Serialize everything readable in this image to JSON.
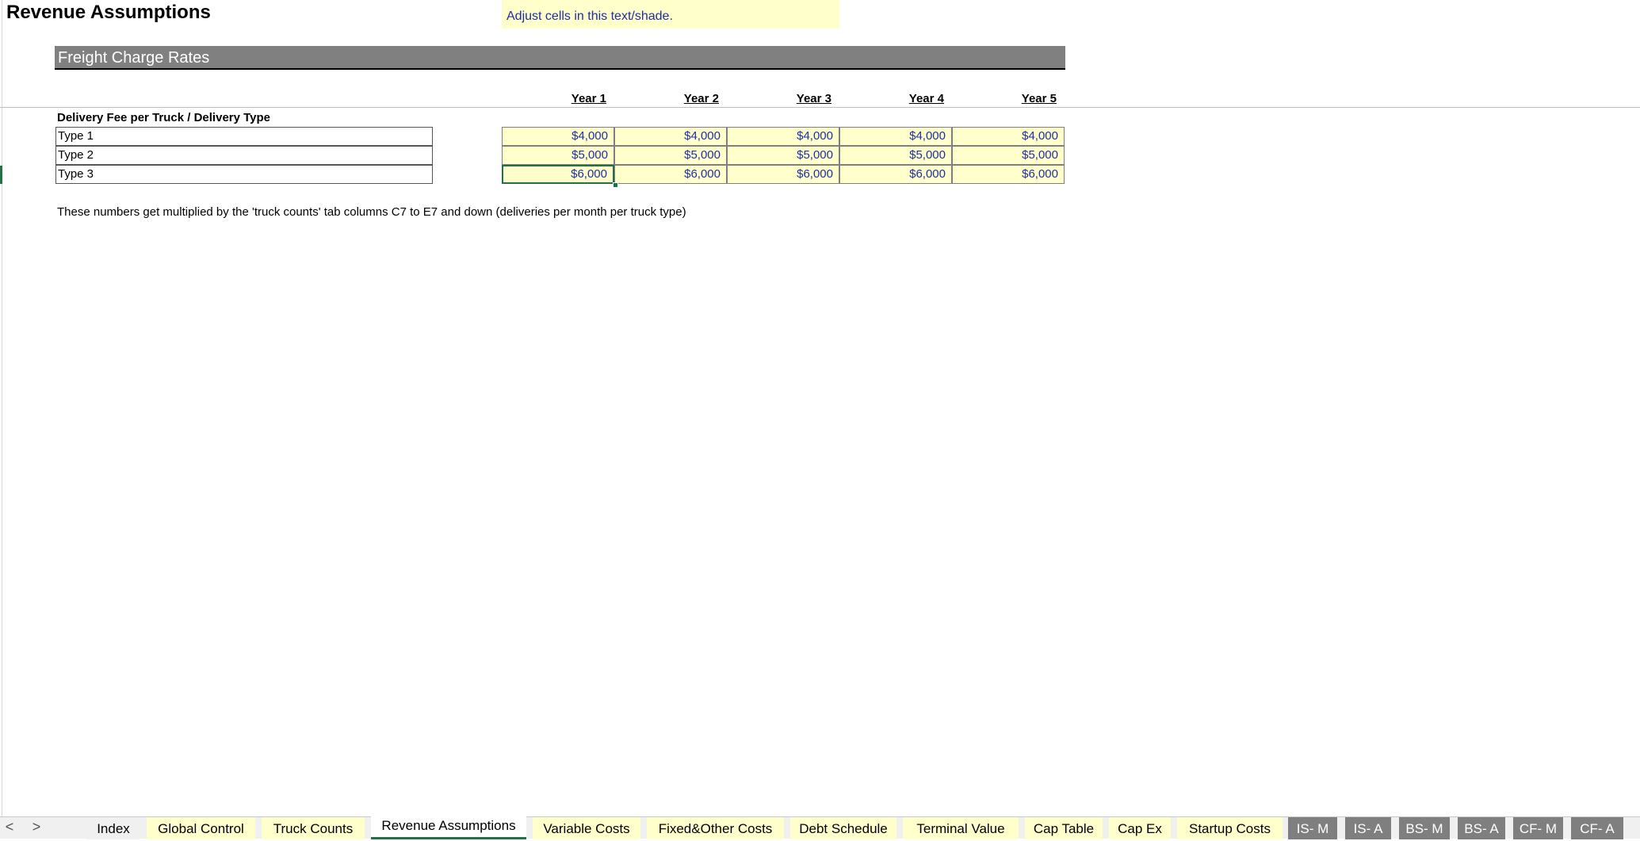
{
  "sheet": {
    "title": "Revenue Assumptions",
    "note": "Adjust cells in this text/shade.",
    "section_title": "Freight Charge Rates",
    "years": [
      "Year 1",
      "Year 2",
      "Year 3",
      "Year 4",
      "Year 5"
    ],
    "table_label": "Delivery Fee per Truck / Delivery Type",
    "rows": [
      {
        "type": "Type 1",
        "values": [
          "$4,000",
          "$4,000",
          "$4,000",
          "$4,000",
          "$4,000"
        ]
      },
      {
        "type": "Type 2",
        "values": [
          "$5,000",
          "$5,000",
          "$5,000",
          "$5,000",
          "$5,000"
        ]
      },
      {
        "type": "Type 3",
        "values": [
          "$6,000",
          "$6,000",
          "$6,000",
          "$6,000",
          "$6,000"
        ]
      }
    ],
    "footnote": "These numbers get multiplied by the 'truck counts' tab columns C7 to E7 and down (deliveries per month per truck type)"
  },
  "tabs": {
    "prev_arrow": "<",
    "next_arrow": ">",
    "items": [
      {
        "label": "Index"
      },
      {
        "label": "Global Control"
      },
      {
        "label": "Truck Counts"
      },
      {
        "label": "Revenue Assumptions"
      },
      {
        "label": "Variable Costs"
      },
      {
        "label": "Fixed&Other Costs"
      },
      {
        "label": "Debt Schedule"
      },
      {
        "label": "Terminal Value"
      },
      {
        "label": "Cap Table"
      },
      {
        "label": "Cap Ex"
      },
      {
        "label": "Startup Costs"
      },
      {
        "label": "IS- M"
      },
      {
        "label": "IS- A"
      },
      {
        "label": "BS- M"
      },
      {
        "label": "BS- A"
      },
      {
        "label": "CF- M"
      },
      {
        "label": "CF- A"
      }
    ]
  },
  "colors": {
    "input_fill": "#ffffcc",
    "input_text": "#1f2fa0",
    "section_fill": "#808080",
    "active_tab_underline": "#217346"
  }
}
